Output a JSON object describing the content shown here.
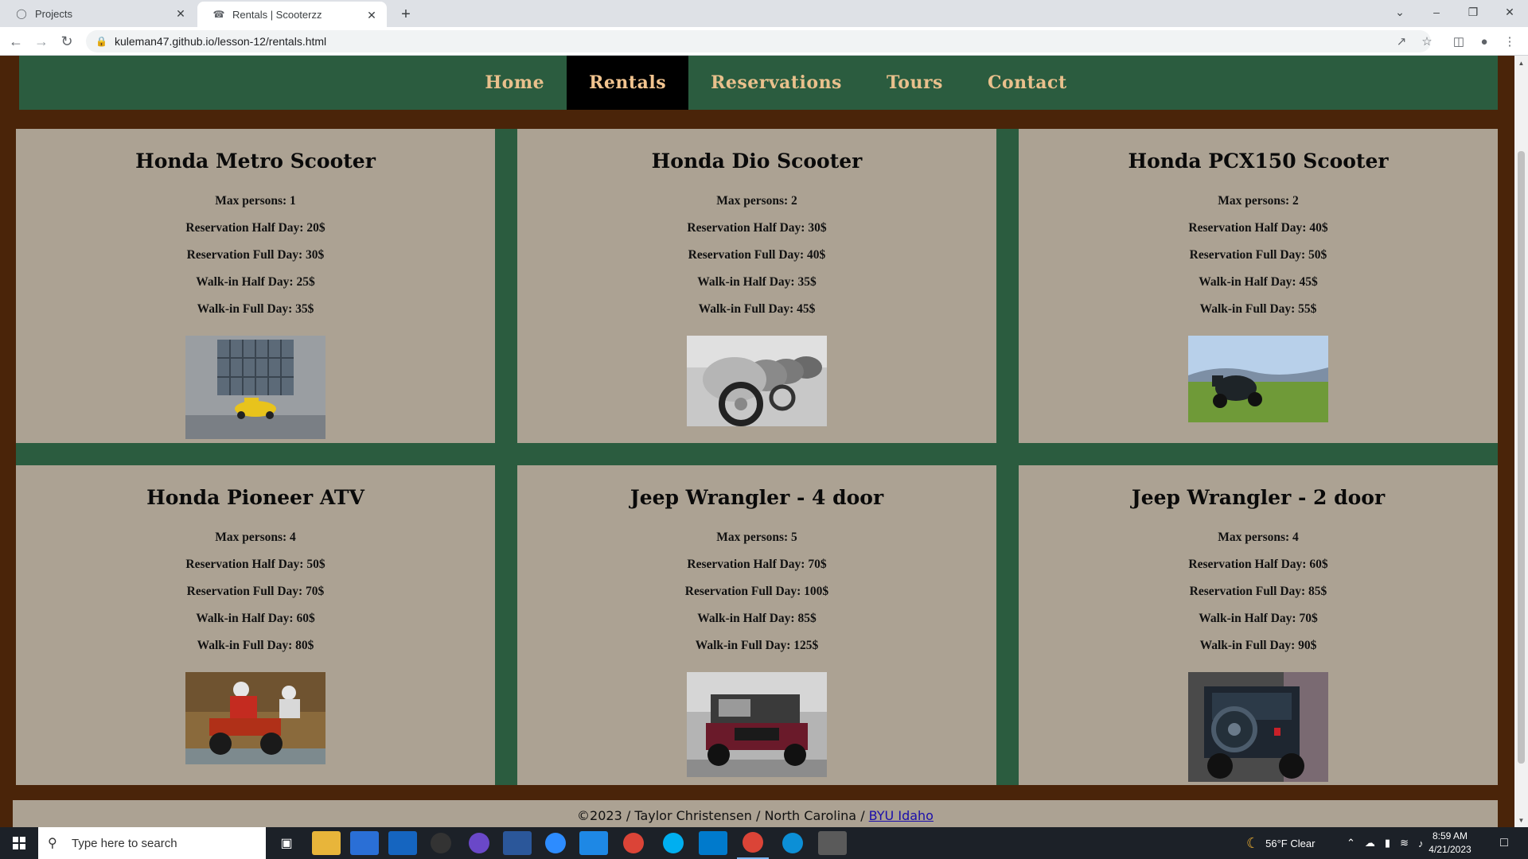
{
  "browser": {
    "tabs": [
      {
        "title": "Projects",
        "icon": "github-icon"
      },
      {
        "title": "Rentals | Scooterzz",
        "icon": "scooter-icon"
      }
    ],
    "url": "kuleman47.github.io/lesson-12/rentals.html"
  },
  "nav": {
    "items": [
      "Home",
      "Rentals",
      "Reservations",
      "Tours",
      "Contact"
    ],
    "active": "Rentals"
  },
  "rentals": [
    {
      "name": "Honda Metro Scooter",
      "max": "Max persons: 1",
      "res_half": "Reservation Half Day: 20$",
      "res_full": "Reservation Full Day: 30$",
      "walk_half": "Walk-in Half Day: 25$",
      "walk_full": "Walk-in Full Day: 35$"
    },
    {
      "name": "Honda Dio Scooter",
      "max": "Max persons: 2",
      "res_half": "Reservation Half Day: 30$",
      "res_full": "Reservation Full Day: 40$",
      "walk_half": "Walk-in Half Day: 35$",
      "walk_full": "Walk-in Full Day: 45$"
    },
    {
      "name": "Honda PCX150 Scooter",
      "max": "Max persons: 2",
      "res_half": "Reservation Half Day: 40$",
      "res_full": "Reservation Full Day: 50$",
      "walk_half": "Walk-in Half Day: 45$",
      "walk_full": "Walk-in Full Day: 55$"
    },
    {
      "name": "Honda Pioneer ATV",
      "max": "Max persons: 4",
      "res_half": "Reservation Half Day: 50$",
      "res_full": "Reservation Full Day: 70$",
      "walk_half": "Walk-in Half Day: 60$",
      "walk_full": "Walk-in Full Day: 80$"
    },
    {
      "name": "Jeep Wrangler - 4 door",
      "max": "Max persons: 5",
      "res_half": "Reservation Half Day: 70$",
      "res_full": "Reservation Full Day: 100$",
      "walk_half": "Walk-in Half Day: 85$",
      "walk_full": "Walk-in Full Day: 125$"
    },
    {
      "name": "Jeep Wrangler - 2 door",
      "max": "Max persons: 4",
      "res_half": "Reservation Half Day: 60$",
      "res_full": "Reservation Full Day: 85$",
      "walk_half": "Walk-in Half Day: 70$",
      "walk_full": "Walk-in Full Day: 90$"
    }
  ],
  "footer": {
    "text": "©2023 / Taylor Christensen / North Carolina / ",
    "link": "BYU Idaho"
  },
  "taskbar": {
    "search_placeholder": "Type here to search",
    "weather": "56°F  Clear",
    "time": "8:59 AM",
    "date": "4/21/2023"
  },
  "colors": {
    "page_bg": "#4a2409",
    "nav_bg": "#2b5c3f",
    "nav_text": "#e9c08c",
    "card_bg": "#aca293"
  }
}
